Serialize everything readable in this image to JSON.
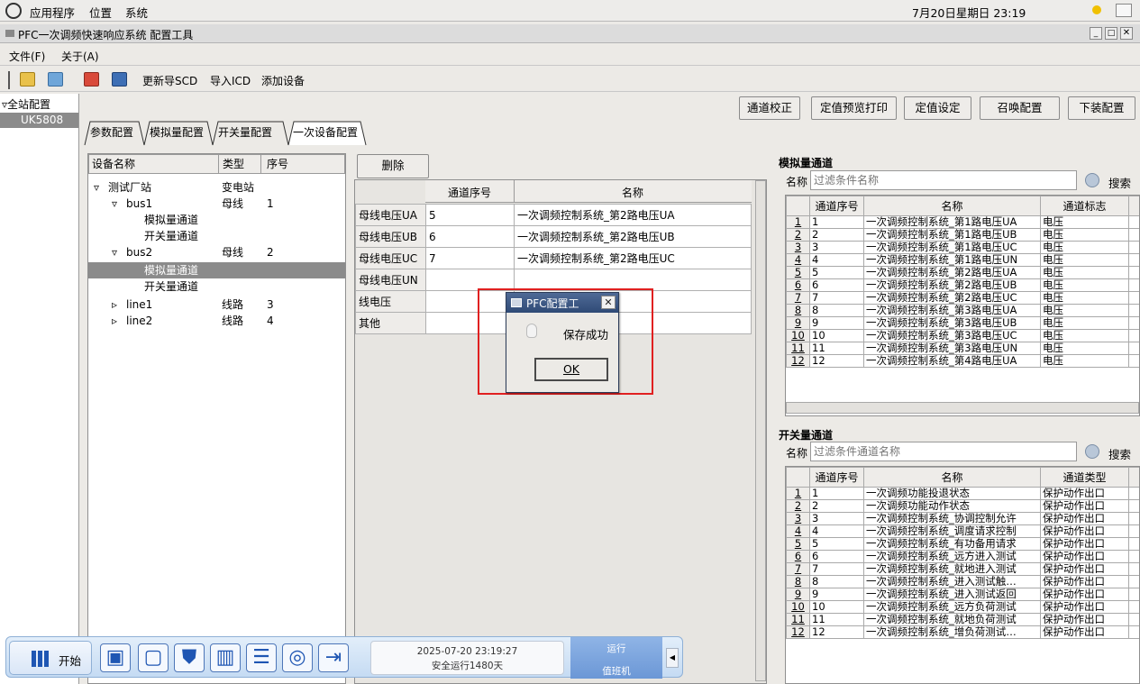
{
  "topbar": {
    "apps": "应用程序",
    "places": "位置",
    "system": "系统",
    "datetime": "7月20日星期日 23:19"
  },
  "window": {
    "title": "PFC一次调频快速响应系统 配置工具"
  },
  "menu": {
    "file": "文件(F)",
    "about": "关于(A)"
  },
  "toolbar": {
    "update_scd": "更新导SCD",
    "import_icd": "导入ICD",
    "add_device": "添加设备"
  },
  "left_tree": {
    "root": "全站配置",
    "device": "UK5808"
  },
  "action_buttons": {
    "calibrate": "通道校正",
    "preview_print": "定值预览打印",
    "set_value": "定值设定",
    "recall": "召唤配置",
    "download": "下装配置"
  },
  "tabs": [
    "参数配置",
    "模拟量配置",
    "开关量配置",
    "一次设备配置"
  ],
  "device_tree": {
    "headers": [
      "设备名称",
      "类型",
      "序号"
    ],
    "rows": [
      {
        "name": "测试厂站",
        "type": "变电站",
        "no": ""
      },
      {
        "name": "bus1",
        "type": "母线",
        "no": "1"
      },
      {
        "name": "模拟量通道",
        "type": "",
        "no": ""
      },
      {
        "name": "开关量通道",
        "type": "",
        "no": ""
      },
      {
        "name": "bus2",
        "type": "母线",
        "no": "2"
      },
      {
        "name": "模拟量通道",
        "type": "",
        "no": ""
      },
      {
        "name": "开关量通道",
        "type": "",
        "no": ""
      },
      {
        "name": "line1",
        "type": "线路",
        "no": "3"
      },
      {
        "name": "line2",
        "type": "线路",
        "no": "4"
      }
    ]
  },
  "channel_map": {
    "delete": "删除",
    "headers": [
      "通道序号",
      "名称"
    ],
    "rows": [
      {
        "label": "母线电压UA",
        "no": "5",
        "name": "一次调频控制系统_第2路电压UA"
      },
      {
        "label": "母线电压UB",
        "no": "6",
        "name": "一次调频控制系统_第2路电压UB"
      },
      {
        "label": "母线电压UC",
        "no": "7",
        "name": "一次调频控制系统_第2路电压UC"
      },
      {
        "label": "母线电压UN",
        "no": "",
        "name": ""
      },
      {
        "label": "线电压",
        "no": "",
        "name": ""
      },
      {
        "label": "其他",
        "no": "",
        "name": ""
      }
    ]
  },
  "analog": {
    "title": "模拟量通道",
    "filter_label": "名称",
    "placeholder": "过滤条件名称",
    "search": "搜索",
    "headers": [
      "通道序号",
      "名称",
      "通道标志"
    ],
    "rows": [
      [
        "1",
        "1",
        "一次调频控制系统_第1路电压UA",
        "电压"
      ],
      [
        "2",
        "2",
        "一次调频控制系统_第1路电压UB",
        "电压"
      ],
      [
        "3",
        "3",
        "一次调频控制系统_第1路电压UC",
        "电压"
      ],
      [
        "4",
        "4",
        "一次调频控制系统_第1路电压UN",
        "电压"
      ],
      [
        "5",
        "5",
        "一次调频控制系统_第2路电压UA",
        "电压"
      ],
      [
        "6",
        "6",
        "一次调频控制系统_第2路电压UB",
        "电压"
      ],
      [
        "7",
        "7",
        "一次调频控制系统_第2路电压UC",
        "电压"
      ],
      [
        "8",
        "8",
        "一次调频控制系统_第3路电压UA",
        "电压"
      ],
      [
        "9",
        "9",
        "一次调频控制系统_第3路电压UB",
        "电压"
      ],
      [
        "10",
        "10",
        "一次调频控制系统_第3路电压UC",
        "电压"
      ],
      [
        "11",
        "11",
        "一次调频控制系统_第3路电压UN",
        "电压"
      ],
      [
        "12",
        "12",
        "一次调频控制系统_第4路电压UA",
        "电压"
      ]
    ]
  },
  "digital": {
    "title": "开关量通道",
    "filter_label": "名称",
    "placeholder": "过滤条件通道名称",
    "search": "搜索",
    "headers": [
      "通道序号",
      "名称",
      "通道类型"
    ],
    "rows": [
      [
        "1",
        "1",
        "一次调频功能投退状态",
        "保护动作出口"
      ],
      [
        "2",
        "2",
        "一次调频功能动作状态",
        "保护动作出口"
      ],
      [
        "3",
        "3",
        "一次调频控制系统_协调控制允许",
        "保护动作出口"
      ],
      [
        "4",
        "4",
        "一次调频控制系统_调度请求控制",
        "保护动作出口"
      ],
      [
        "5",
        "5",
        "一次调频控制系统_有功备用请求",
        "保护动作出口"
      ],
      [
        "6",
        "6",
        "一次调频控制系统_远方进入测试",
        "保护动作出口"
      ],
      [
        "7",
        "7",
        "一次调频控制系统_就地进入测试",
        "保护动作出口"
      ],
      [
        "8",
        "8",
        "一次调频控制系统_进入测试触…",
        "保护动作出口"
      ],
      [
        "9",
        "9",
        "一次调频控制系统_进入测试返回",
        "保护动作出口"
      ],
      [
        "10",
        "10",
        "一次调频控制系统_远方负荷测试",
        "保护动作出口"
      ],
      [
        "11",
        "11",
        "一次调频控制系统_就地负荷测试",
        "保护动作出口"
      ],
      [
        "12",
        "12",
        "一次调频控制系统_增负荷测试…",
        "保护动作出口"
      ]
    ]
  },
  "dialog": {
    "title": "PFC配置工",
    "message": "保存成功",
    "ok": "OK"
  },
  "taskbar": {
    "start": "开始",
    "datetime": "2025-07-20 23:19:27",
    "uptime": "安全运行1480天",
    "status": "运行",
    "duty": "值班机"
  }
}
